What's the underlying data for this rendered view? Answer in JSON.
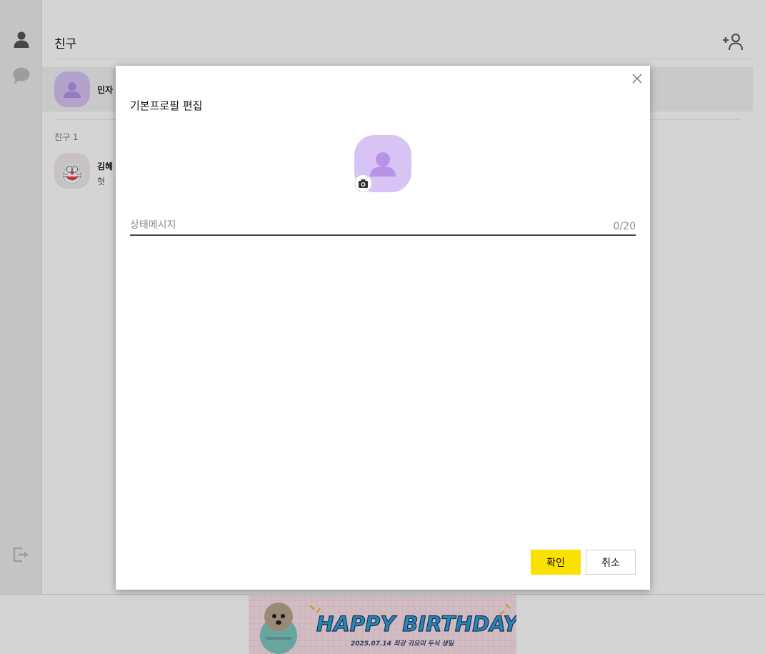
{
  "main": {
    "title": "친구",
    "my_profile": {
      "name": "민자"
    },
    "friends_section": {
      "label": "친구 1"
    },
    "friends": [
      {
        "name": "김혜",
        "status": "헛"
      }
    ]
  },
  "banner": {
    "headline": "HAPPY BIRTHDAY",
    "subline": "2025.07.14 최강 귀요미 두식 생일"
  },
  "modal": {
    "title": "기본프로필 편집",
    "status_placeholder": "상태메시지",
    "status_value": "",
    "char_count": "0/20",
    "confirm_label": "확인",
    "cancel_label": "취소"
  },
  "colors": {
    "accent_yellow": "#fae100",
    "avatar_purple": "#d8c4f4",
    "avatar_figure": "#b793e8"
  },
  "icons": {
    "sidebar": [
      "person-icon",
      "chat-bubble-icon",
      "logout-icon"
    ],
    "header": "add-friend-icon",
    "modal": [
      "close-icon",
      "camera-icon"
    ]
  }
}
